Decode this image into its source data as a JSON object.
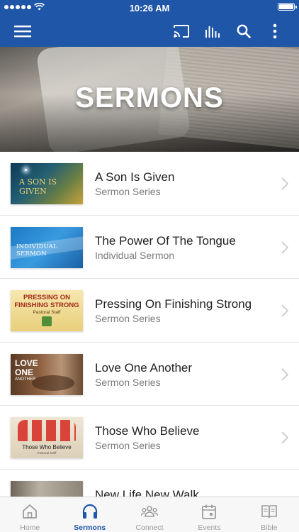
{
  "status_bar": {
    "time": "10:26 AM",
    "signal_icon": "signal-dots-icon",
    "wifi_icon": "wifi-icon",
    "battery_icon": "battery-icon"
  },
  "nav_bar": {
    "menu_icon": "hamburger-menu-icon",
    "cast_icon": "cast-icon",
    "audio_icon": "audio-bars-icon",
    "search_icon": "search-icon",
    "more_icon": "more-vertical-icon",
    "background_color": "#1f56a8"
  },
  "hero": {
    "title": "SERMONS"
  },
  "sermons": [
    {
      "title": "A Son Is Given",
      "subtitle": "Sermon Series",
      "thumb_text": "A SON IS GIVEN"
    },
    {
      "title": "The Power Of The Tongue",
      "subtitle": "Individual Sermon",
      "thumb_text": "INDIVIDUAL SERMON"
    },
    {
      "title": "Pressing On Finishing Strong",
      "subtitle": "Sermon Series",
      "thumb_lines": [
        "PRESSING ON",
        "FINISHING STRONG",
        "Pastoral Staff"
      ]
    },
    {
      "title": "Love One Another",
      "subtitle": "Sermon Series",
      "thumb_lines": [
        "LOVE",
        "ONE",
        "ANOTHER"
      ]
    },
    {
      "title": "Those Who Believe",
      "subtitle": "Sermon Series",
      "thumb_lines": [
        "Those Who Believe",
        "Pastoral Staff"
      ]
    },
    {
      "title": "New Life New Walk",
      "subtitle": ""
    }
  ],
  "tab_bar": {
    "active_color": "#1f56a8",
    "inactive_color": "#9b9b9b",
    "tabs": [
      {
        "label": "Home",
        "icon": "home-icon",
        "active": false
      },
      {
        "label": "Sermons",
        "icon": "headphones-icon",
        "active": true
      },
      {
        "label": "Connect",
        "icon": "people-icon",
        "active": false
      },
      {
        "label": "Events",
        "icon": "calendar-icon",
        "active": false
      },
      {
        "label": "Bible",
        "icon": "open-book-icon",
        "active": false
      }
    ]
  }
}
